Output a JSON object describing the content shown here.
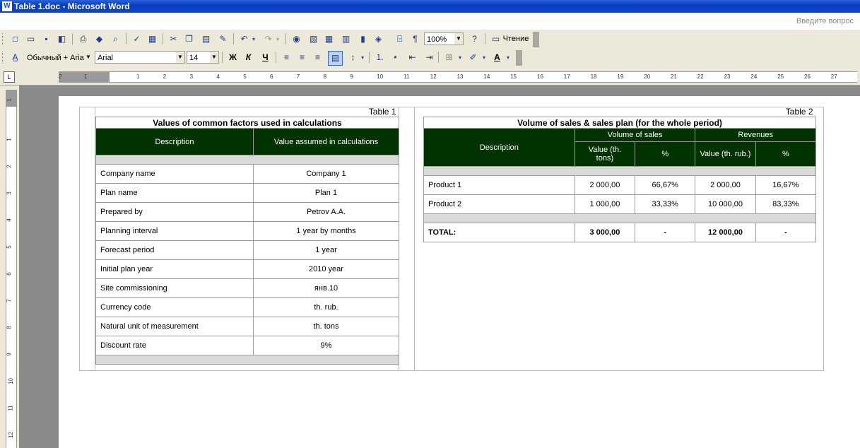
{
  "window": {
    "title": "Table 1.doc - Microsoft Word",
    "app_icon": "W"
  },
  "helpbox": {
    "placeholder": "Введите вопрос"
  },
  "toolbar": {
    "zoom": "100%",
    "read_label": "Чтение",
    "style": "Обычный + Aria",
    "font": "Arial",
    "size": "14",
    "bold": "Ж",
    "italic": "К",
    "underline": "Ч",
    "pilcrow": "¶",
    "font_color": "A"
  },
  "ruler": {
    "h_ticks": [
      "2",
      "1",
      "1",
      "2",
      "3",
      "4",
      "5",
      "6",
      "7",
      "8",
      "9",
      "10",
      "11",
      "12",
      "13",
      "14",
      "15",
      "16",
      "17",
      "18",
      "19",
      "20",
      "21",
      "22",
      "23",
      "24",
      "25",
      "26",
      "27"
    ],
    "v_ticks": [
      "1",
      "1",
      "2",
      "3",
      "4",
      "5",
      "6",
      "7",
      "8",
      "9",
      "10",
      "11",
      "12"
    ]
  },
  "table1": {
    "caption": "Table 1",
    "title": "Values of common factors used in calculations",
    "headers": [
      "Description",
      "Value assumed in calculations"
    ],
    "rows": [
      [
        "Company name",
        "Company 1"
      ],
      [
        "Plan name",
        "Plan 1"
      ],
      [
        "Prepared by",
        "Petrov A.A."
      ],
      [
        "Planning interval",
        "1 year by months"
      ],
      [
        "Forecast period",
        "1 year"
      ],
      [
        "Initial plan year",
        "2010 year"
      ],
      [
        "Site commissioning",
        "янв.10"
      ],
      [
        "Currency code",
        "th. rub."
      ],
      [
        "Natural unit of measurement",
        "th. tons"
      ],
      [
        "Discount rate",
        "9%"
      ]
    ]
  },
  "table2": {
    "caption": "Table 2",
    "title": "Volume of sales & sales plan (for the whole period)",
    "desc_header": "Description",
    "group_volume": "Volume of sales",
    "group_revenue": "Revenues",
    "sub_value_tons": "Value (th. tons)",
    "sub_pct": "%",
    "sub_value_rub": "Value (th. rub.)",
    "sub_pct2": "%",
    "rows": [
      [
        "Product 1",
        "2 000,00",
        "66,67%",
        "2 000,00",
        "16,67%"
      ],
      [
        "Product 2",
        "1 000,00",
        "33,33%",
        "10 000,00",
        "83,33%"
      ]
    ],
    "total": [
      "TOTAL:",
      "3 000,00",
      "-",
      "12 000,00",
      "-"
    ]
  }
}
